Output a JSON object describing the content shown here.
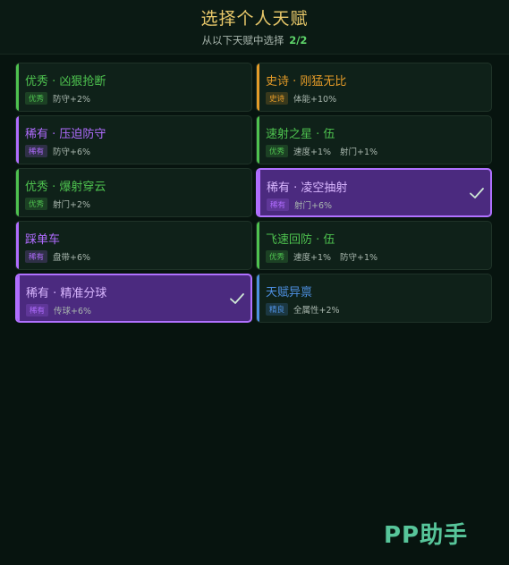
{
  "header": {
    "title": "选择个人天赋",
    "subtitle_prefix": "从以下天赋中选择",
    "selection_count": "2/2"
  },
  "rarity_colors": {
    "优秀": "#4ec24f",
    "史诗": "#e39a28",
    "稀有": "#b06cff",
    "精良": "#4d8fe0"
  },
  "talents": [
    {
      "name": "优秀 · 凶狠抢断",
      "rarity": "优秀",
      "stats": [
        "防守+2%"
      ],
      "selected": false
    },
    {
      "name": "史诗 · 刚猛无比",
      "rarity": "史诗",
      "stats": [
        "体能+10%"
      ],
      "selected": false
    },
    {
      "name": "稀有 · 压迫防守",
      "rarity": "稀有",
      "stats": [
        "防守+6%"
      ],
      "selected": false
    },
    {
      "name": "速射之星 · 伍",
      "rarity": "优秀",
      "stats": [
        "速度+1%",
        "射门+1%"
      ],
      "selected": false
    },
    {
      "name": "优秀 · 爆射穿云",
      "rarity": "优秀",
      "stats": [
        "射门+2%"
      ],
      "selected": false
    },
    {
      "name": "稀有 · 凌空抽射",
      "rarity": "稀有",
      "stats": [
        "射门+6%"
      ],
      "selected": true
    },
    {
      "name": "踩单车",
      "rarity": "稀有",
      "stats": [
        "盘带+6%"
      ],
      "selected": false
    },
    {
      "name": "飞速回防 · 伍",
      "rarity": "优秀",
      "stats": [
        "速度+1%",
        "防守+1%"
      ],
      "selected": false
    },
    {
      "name": "稀有 · 精准分球",
      "rarity": "稀有",
      "stats": [
        "传球+6%"
      ],
      "selected": true
    },
    {
      "name": "天赋异禀",
      "rarity": "精良",
      "stats": [
        "全属性+2%"
      ],
      "selected": false
    }
  ],
  "watermark": "PP助手"
}
